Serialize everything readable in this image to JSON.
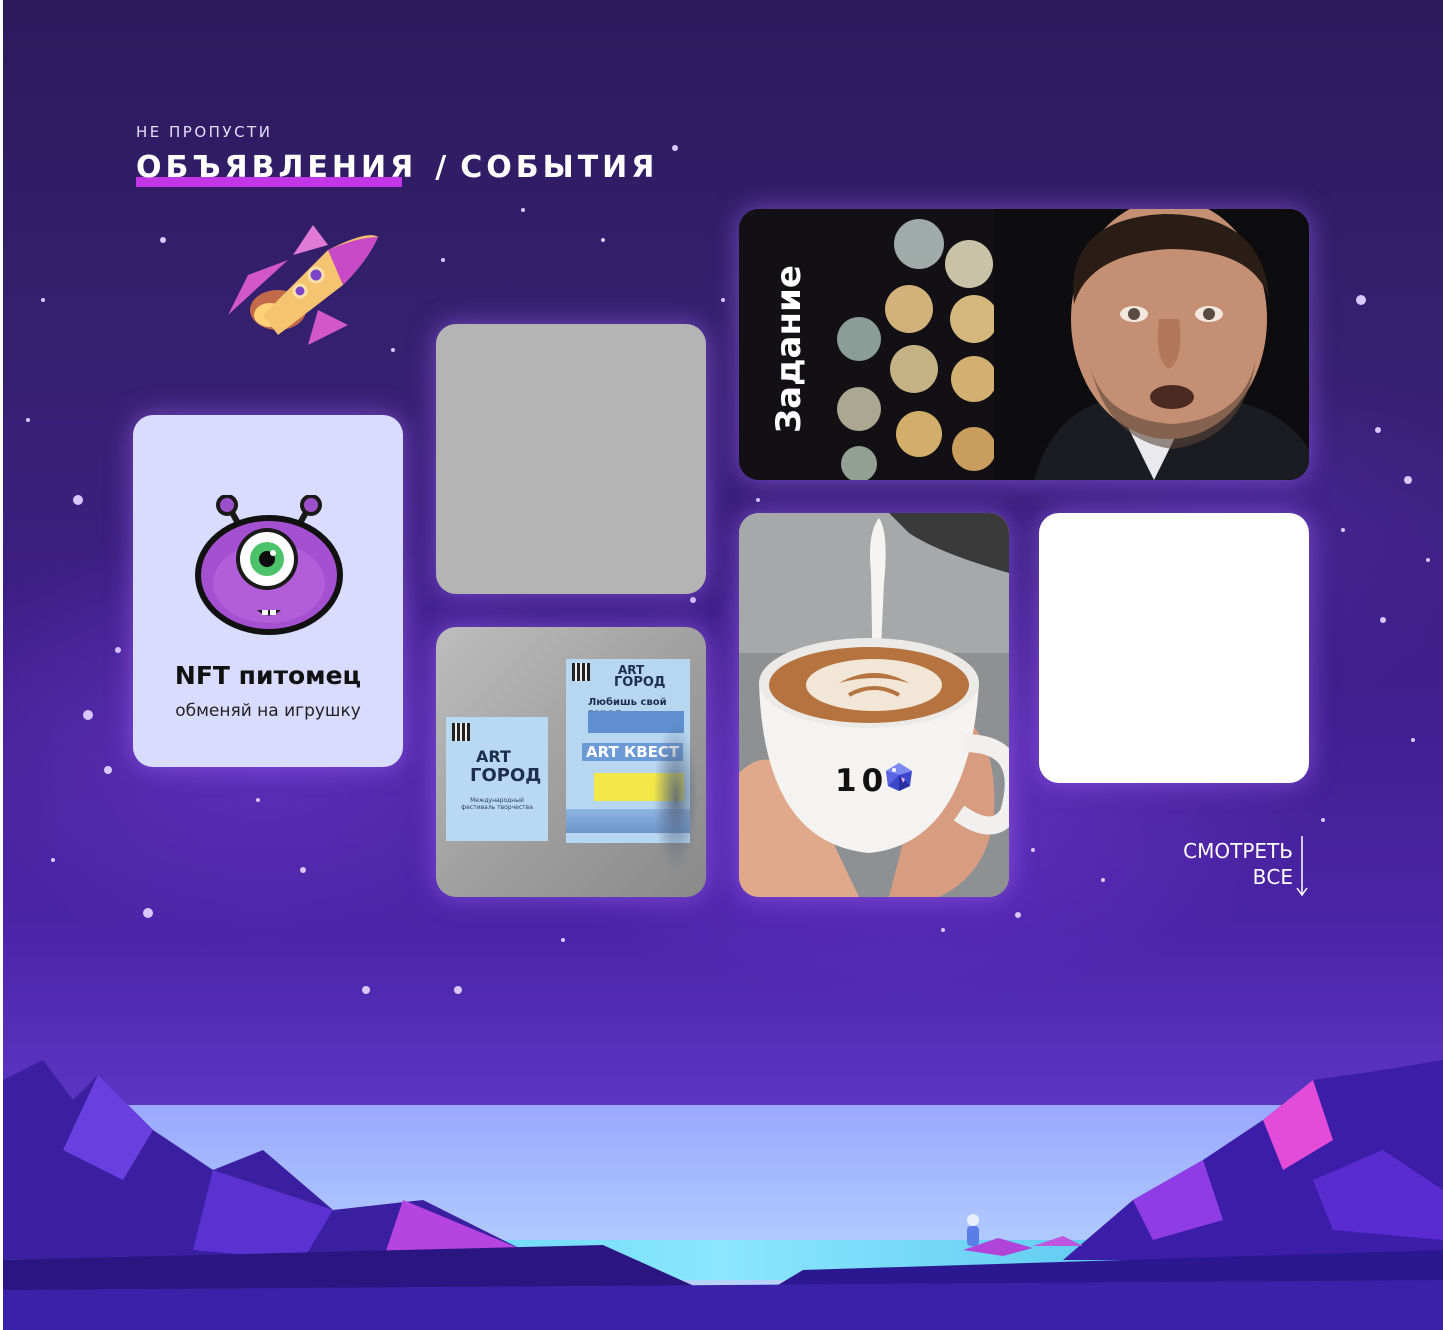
{
  "header": {
    "subtitle": "НЕ ПРОПУСТИ",
    "title_primary": "ОБЪЯВЛЕНИЯ",
    "title_separator": "/",
    "title_secondary": "СОБЫТИЯ"
  },
  "cards": {
    "nft": {
      "title": "NFT питомец",
      "subtitle": "обменяй на игрушку"
    },
    "posters": {
      "poster_a_title_1": "ART",
      "poster_a_title_2": "ГОРОД",
      "poster_a_caption": "Международный фестиваль творчества",
      "poster_b_title_1": "ART",
      "poster_b_title_2": "ГОРОД",
      "poster_b_headline": "Любишь свой город",
      "poster_b_quest": "ART КВЕСТ"
    },
    "task": {
      "label": "Задание"
    },
    "coffee": {
      "price": "10"
    }
  },
  "see_all": {
    "line1": "СМОТРЕТЬ",
    "line2": "ВСЕ"
  },
  "colors": {
    "background_top": "#2c1a5c",
    "background_bottom": "#5b4cc8",
    "accent_underline": "#c236e6",
    "nft_card_bg": "#d9dbff",
    "gray_card_bg": "#b4b4b4",
    "white_card_bg": "#ffffff"
  },
  "icons": {
    "rocket": "rocket-illustration",
    "nft_pet": "purple-one-eyed-monster",
    "currency": "crystal-gem-icon",
    "see_all_arrow": "arrow-down-icon"
  }
}
